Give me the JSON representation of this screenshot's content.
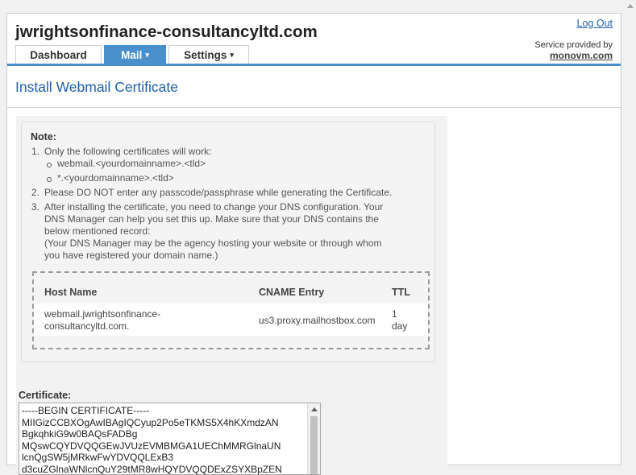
{
  "header": {
    "site_title": "jwrightsonfinance-consultancyltd.com",
    "logout": "Log Out",
    "service_label": "Service provided by",
    "service_brand": "monovm.com"
  },
  "tabs": [
    {
      "label": "Dashboard",
      "active": false
    },
    {
      "label": "Mail",
      "active": true,
      "caret": "▾"
    },
    {
      "label": "Settings",
      "active": false,
      "caret": "▾"
    }
  ],
  "page": {
    "title": "Install Webmail Certificate"
  },
  "note": {
    "heading": "Note:",
    "item1": {
      "num": "1.",
      "text": "Only the following certificates will work:",
      "subitems": [
        "webmail.<yourdomainname>.<tld>",
        "*.<yourdomainname>.<tld>"
      ]
    },
    "item2": {
      "num": "2.",
      "text": "Please DO NOT enter any passcode/passphrase while generating the Certificate."
    },
    "item3": {
      "num": "3.",
      "lines": [
        "After installing the certificate, you need to change your DNS configuration. Your",
        "DNS Manager can help you set this up. Make sure that your DNS contains the",
        "below mentioned record:",
        "(Your DNS Manager may be the agency hosting your website or through whom",
        "you have registered your domain name.)"
      ]
    }
  },
  "dns_table": {
    "headers": {
      "host": "Host Name",
      "cname": "CNAME Entry",
      "ttl": "TTL"
    },
    "row": {
      "host_lines": [
        "webmail.jwrightsonfinance-",
        "consultancyltd.com."
      ],
      "cname": "us3.proxy.mailhostbox.com",
      "ttl_lines": [
        "1",
        "day"
      ]
    }
  },
  "certificate": {
    "label": "Certificate:",
    "lines": [
      "-----BEGIN CERTIFICATE-----",
      "MIIGizCCBXOgAwIBAgIQCyup2Po5eTKMS5X4hKXmdzAN",
      "BgkqhkiG9w0BAQsFADBg",
      "MQswCQYDVQQGEwJVUzEVMBMGA1UEChMMRGlnaUN",
      "lcnQgSW5jMRkwFwYDVQQLExB3",
      "d3cuZGlnaWNlcnQuY29tMR8wHQYDVQQDExZSYXBpZEN"
    ]
  }
}
